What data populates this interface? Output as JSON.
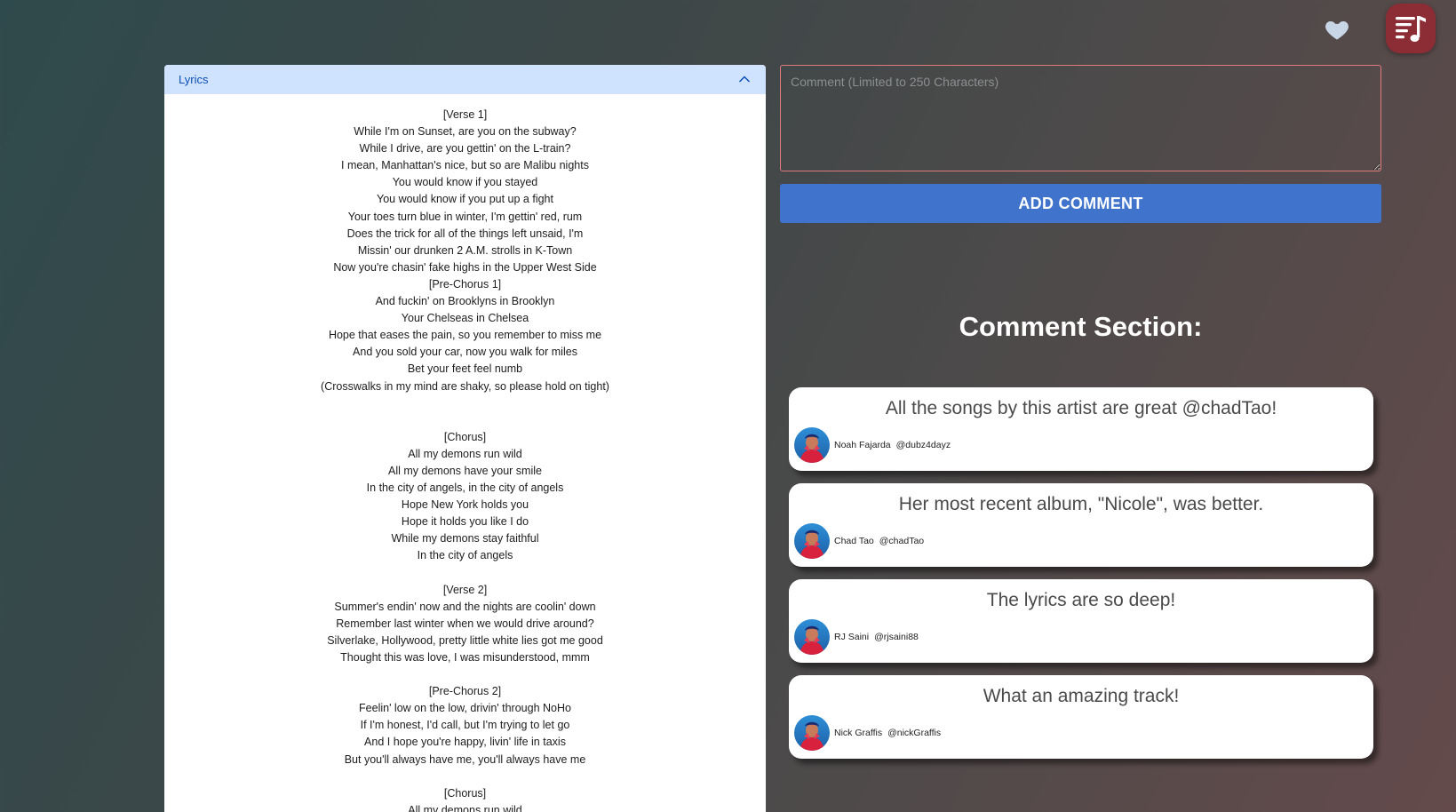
{
  "lyrics": {
    "title": "Lyrics",
    "lines": [
      "[Verse 1]",
      "While I'm on Sunset, are you on the subway?",
      "While I drive, are you gettin' on the L-train?",
      "I mean, Manhattan's nice, but so are Malibu nights",
      "You would know if you stayed",
      "You would know if you put up a fight",
      "Your toes turn blue in winter, I'm gettin' red, rum",
      "Does the trick for all of the things left unsaid, I'm",
      "Missin' our drunken 2 A.M. strolls in K-Town",
      "Now you're chasin' fake highs in the Upper West Side",
      "[Pre-Chorus 1]",
      "And fuckin' on Brooklyns in Brooklyn",
      "Your Chelseas in Chelsea",
      "Hope that eases the pain, so you remember to miss me",
      "And you sold your car, now you walk for miles",
      "Bet your feet feel numb",
      "(Crosswalks in my mind are shaky, so please hold on tight)",
      "",
      "",
      "[Chorus]",
      "All my demons run wild",
      "All my demons have your smile",
      "In the city of angels, in the city of angels",
      "Hope New York holds you",
      "Hope it holds you like I do",
      "While my demons stay faithful",
      "In the city of angels",
      "",
      "[Verse 2]",
      "Summer's endin' now and the nights are coolin' down",
      "Remember last winter when we would drive around?",
      "Silverlake, Hollywood, pretty little white lies got me good",
      "Thought this was love, I was misunderstood, mmm",
      "",
      "[Pre-Chorus 2]",
      "Feelin' low on the low, drivin' through NoHo",
      "If I'm honest, I'd call, but I'm trying to let go",
      "And I hope you're happy, livin' life in taxis",
      "But you'll always have me, you'll always have me",
      "",
      "[Chorus]",
      "All my demons run wild"
    ]
  },
  "comment_input": {
    "placeholder": "Comment (Limited to 250 Characters)",
    "value": ""
  },
  "add_button": "ADD COMMENT",
  "section_title": "Comment Section:",
  "comments": [
    {
      "text": "All the songs by this artist are great @chadTao!",
      "name": "Noah Fajarda",
      "handle": "@dubz4dayz"
    },
    {
      "text": "Her most recent album, \"Nicole\", was better.",
      "name": "Chad Tao",
      "handle": "@chadTao"
    },
    {
      "text": "The lyrics are so deep!",
      "name": "RJ Saini",
      "handle": "@rjsaini88"
    },
    {
      "text": "What an amazing track!",
      "name": "Nick Graffis",
      "handle": "@nickGraffis"
    }
  ],
  "icons": {
    "favorite": "heart-icon",
    "logo": "music-playlist-icon",
    "collapse": "chevron-up-icon"
  },
  "colors": {
    "lyrics_header_bg": "#cfe2fe",
    "lyrics_header_text": "#0c4fb8",
    "button": "#3f73cc",
    "logo_bg": "#8c2c35",
    "input_border": "#e07b7b"
  }
}
